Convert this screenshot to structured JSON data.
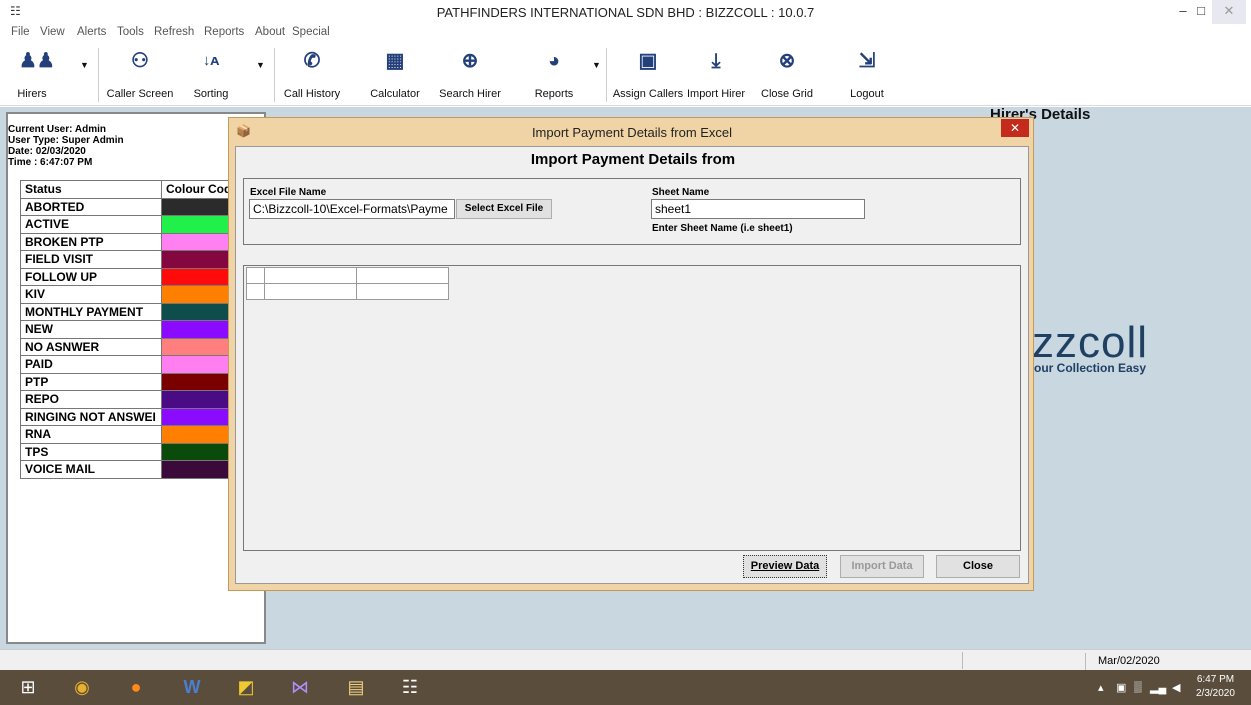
{
  "window": {
    "title": "PATHFINDERS INTERNATIONAL SDN BHD  :  BIZZCOLL  : 10.0.7",
    "app_icon": "app-grid-icon",
    "controls": [
      "–",
      "□",
      "✕"
    ]
  },
  "menu": [
    "File",
    "View",
    "Alerts",
    "Tools",
    "Refresh",
    "Reports",
    "About",
    "Special"
  ],
  "toolbar": [
    {
      "label": "Hirers",
      "icon": "users-icon",
      "dropdown": true
    },
    {
      "label": "Caller Screen",
      "icon": "callers-icon",
      "dropdown": false
    },
    {
      "label": "Sorting",
      "icon": "sort-az-icon",
      "dropdown": true
    },
    {
      "label": "Call History",
      "icon": "phone-icon",
      "dropdown": false
    },
    {
      "label": "Calculator",
      "icon": "calculator-icon",
      "dropdown": false
    },
    {
      "label": "Search Hirer",
      "icon": "search-icon",
      "dropdown": false
    },
    {
      "label": "Reports",
      "icon": "pie-chart-icon",
      "dropdown": true
    },
    {
      "label": "Assign Callers",
      "icon": "contact-card-icon",
      "dropdown": false
    },
    {
      "label": "Import Hirer",
      "icon": "download-icon",
      "dropdown": false
    },
    {
      "label": "Close Grid",
      "icon": "close-circle-icon",
      "dropdown": false
    },
    {
      "label": "Logout",
      "icon": "logout-icon",
      "dropdown": false
    }
  ],
  "user_info": {
    "current_user": "Current User: Admin",
    "user_type": "User Type: Super Admin",
    "date": "Date: 02/03/2020",
    "time": "Time : 6:47:07 PM"
  },
  "status_table": {
    "headers": [
      "Status",
      "Colour Cod"
    ],
    "rows": [
      {
        "status": "ABORTED",
        "color": "#2b2b2b"
      },
      {
        "status": "ACTIVE",
        "color": "#22f04a"
      },
      {
        "status": "BROKEN PTP",
        "color": "#ff80f0"
      },
      {
        "status": "FIELD VISIT",
        "color": "#84073f"
      },
      {
        "status": "FOLLOW UP",
        "color": "#ff0b0b"
      },
      {
        "status": "KIV",
        "color": "#ff7f00"
      },
      {
        "status": "MONTHLY PAYMENT",
        "color": "#0f4c4c"
      },
      {
        "status": "NEW",
        "color": "#8a0bff"
      },
      {
        "status": "NO ASNWER",
        "color": "#ff7f7f"
      },
      {
        "status": "PAID",
        "color": "#ff7ff0"
      },
      {
        "status": "PTP",
        "color": "#7a0000"
      },
      {
        "status": "REPO",
        "color": "#4b0b84"
      },
      {
        "status": "RINGING NOT ANSWEI",
        "color": "#8a0bff"
      },
      {
        "status": "RNA",
        "color": "#ff7f00"
      },
      {
        "status": "TPS",
        "color": "#0a4a0a"
      },
      {
        "status": "VOICE MAIL",
        "color": "#3a0a3a"
      }
    ]
  },
  "background": {
    "hirer_title": "Hirer's Details",
    "logo_text": "zzcoll",
    "logo_tagline": "our Collection Easy"
  },
  "dialog": {
    "title": "Import Payment Details from Excel",
    "heading": "Import Payment Details from",
    "icon": "wizard-icon",
    "close_glyph": "✕",
    "excel_label": "Excel File Name",
    "excel_value": "C:\\Bizzcoll-10\\Excel-Formats\\Payme",
    "select_button": "Select Excel File",
    "sheet_label": "Sheet Name",
    "sheet_value": "sheet1",
    "sheet_hint": "Enter Sheet Name (i.e  sheet1)",
    "preview_button": "Preview Data",
    "import_button": "Import Data",
    "close_button": "Close"
  },
  "statusbar": {
    "date": "Mar/02/2020"
  },
  "taskbar": {
    "apps": [
      "windows-start-icon",
      "chrome-icon",
      "firefox-icon",
      "word-icon",
      "media-icon",
      "visual-studio-icon",
      "file-explorer-icon",
      "app-grid-icon"
    ],
    "time": "6:47 PM",
    "date": "2/3/2020"
  },
  "colors": {
    "workspace": "#c8d7e0",
    "dialog_frame": "#f0d4a6",
    "dialog_close": "#c42b1c",
    "taskbar": "#5a4d3c",
    "icon_blue": "#23407a"
  }
}
